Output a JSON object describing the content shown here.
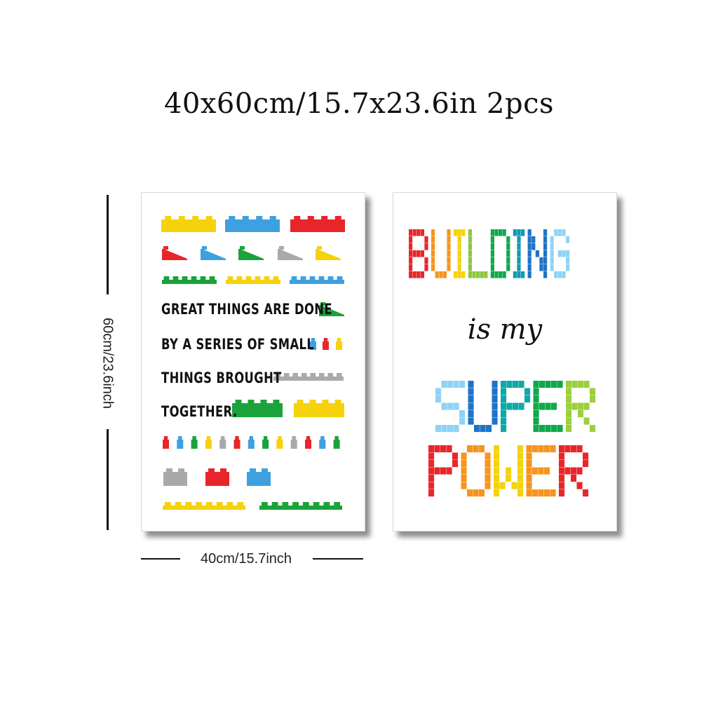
{
  "title": "40x60cm/15.7x23.6in 2pcs",
  "dimensions": {
    "height_label": "60cm/23.6inch",
    "width_label": "40cm/15.7inch"
  },
  "left_poster": {
    "quote_lines": [
      "GREAT THINGS ARE DONE",
      "BY A SERIES OF SMALL",
      "THINGS BROUGHT",
      "TOGETHER."
    ]
  },
  "right_poster": {
    "word_building": "BUILDING",
    "word_is_my": "is my",
    "word_super": "SUPER",
    "word_power": "POWER",
    "building_colors": [
      "#e8262a",
      "#f7941d",
      "#f5d20c",
      "#8dc63f",
      "#0fa84a",
      "#0f9bb0",
      "#1e73c6",
      "#8fd3f4"
    ],
    "super_colors": [
      "#8fd3f4",
      "#1e73c6",
      "#0fa8a8",
      "#0fa84a",
      "#9ccf3c"
    ],
    "power_colors": [
      "#e8262a",
      "#f7941d",
      "#f5d20c",
      "#f7941d",
      "#e8262a"
    ]
  },
  "colors": {
    "yellow": "#f5d20c",
    "blue": "#3fa0e0",
    "red": "#e8262a",
    "green": "#1aa33a",
    "gray": "#a9a9a9"
  }
}
